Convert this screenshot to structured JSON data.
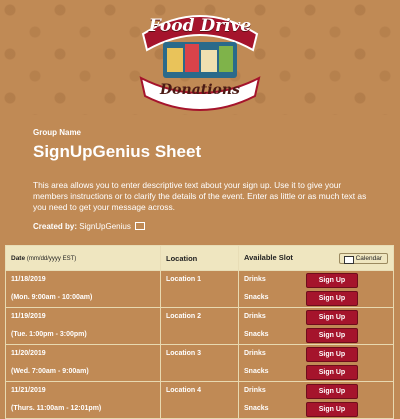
{
  "header": {
    "logo_top": "Food Drive",
    "logo_bottom": "Donations"
  },
  "group_name": "Group Name",
  "sheet_title": "SignUpGenius Sheet",
  "description": "This area allows you to enter descriptive text about your sign up. Use it to give your members instructions or to clarify the details of the event. Enter as little or as much text as you need to get your message across.",
  "created_by": {
    "label": "Created by:",
    "name": "SignUpGenius"
  },
  "table": {
    "headers": {
      "date": "Date",
      "date_format": "(mm/dd/yyyy EST)",
      "location": "Location",
      "slot": "Available Slot",
      "calendar": "Calendar"
    },
    "signup_label": "Sign Up",
    "rows": [
      {
        "date": "11/18/2019",
        "time": "(Mon. 9:00am - 10:00am)",
        "location": "Location 1",
        "slots": [
          "Drinks",
          "Snacks"
        ]
      },
      {
        "date": "11/19/2019",
        "time": "(Tue. 1:00pm - 3:00pm)",
        "location": "Location 2",
        "slots": [
          "Drinks",
          "Snacks"
        ]
      },
      {
        "date": "11/20/2019",
        "time": "(Wed. 7:00am - 9:00am)",
        "location": "Location 3",
        "slots": [
          "Drinks",
          "Snacks"
        ]
      },
      {
        "date": "11/21/2019",
        "time": "(Thurs. 11:00am - 12:01pm)",
        "location": "Location 4",
        "slots": [
          "Drinks",
          "Snacks"
        ]
      }
    ]
  },
  "colors": {
    "background": "#c08a55",
    "header_row": "#efe6c0",
    "signup_button": "#a5142c"
  }
}
